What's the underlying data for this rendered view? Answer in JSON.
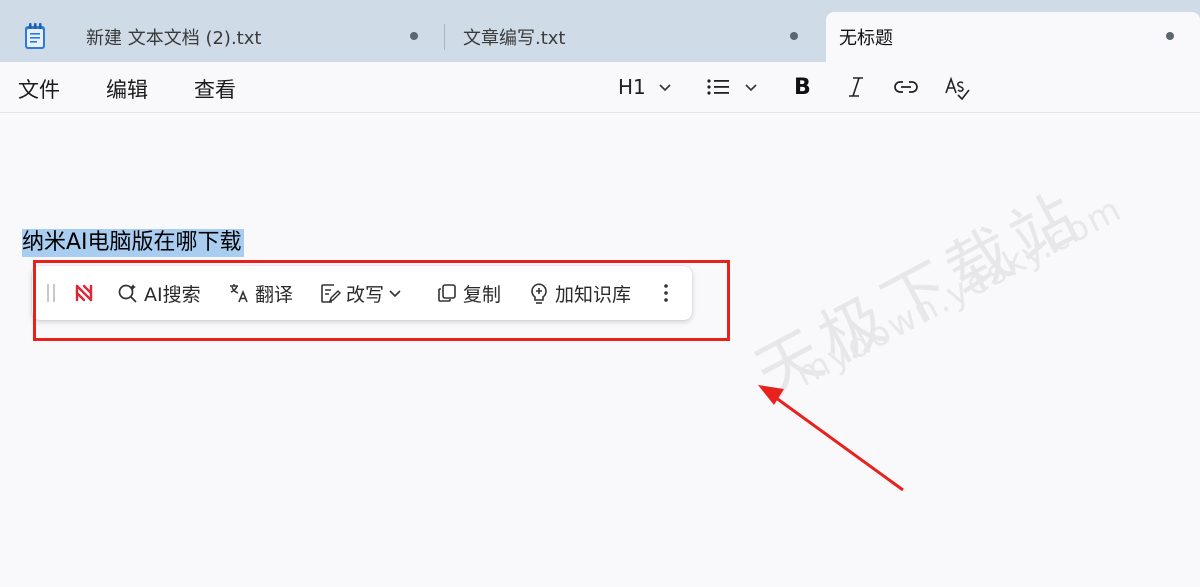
{
  "tabs": [
    {
      "title": "新建 文本文档 (2).txt",
      "active": false
    },
    {
      "title": "文章编写.txt",
      "active": false
    },
    {
      "title": "无标题",
      "active": true
    }
  ],
  "menu": [
    "文件",
    "编辑",
    "查看"
  ],
  "format_toolbar": {
    "heading_value": "H1",
    "list_icon": "bullet-list-icon",
    "bold_label": "B",
    "italic_icon": "italic-icon",
    "link_icon": "link-icon",
    "spellcheck_icon": "spellcheck-icon"
  },
  "editor": {
    "selected_text": "纳米AI电脑版在哪下载"
  },
  "ai_toolbar": {
    "logo_icon": "nami-ai-logo-icon",
    "ai_search_label": "AI搜索",
    "translate_label": "翻译",
    "rewrite_label": "改写",
    "copy_label": "复制",
    "knowledge_base_label": "加知识库",
    "more_icon": "more-vertical-icon"
  },
  "watermark": {
    "line1": "天极下载站",
    "line2": "mydown.yesky.com"
  },
  "colors": {
    "tabbar_bg": "#cfdce8",
    "selection": "#a9cdf0",
    "annotation_red": "#e8211d",
    "logo_red": "#e02438"
  }
}
